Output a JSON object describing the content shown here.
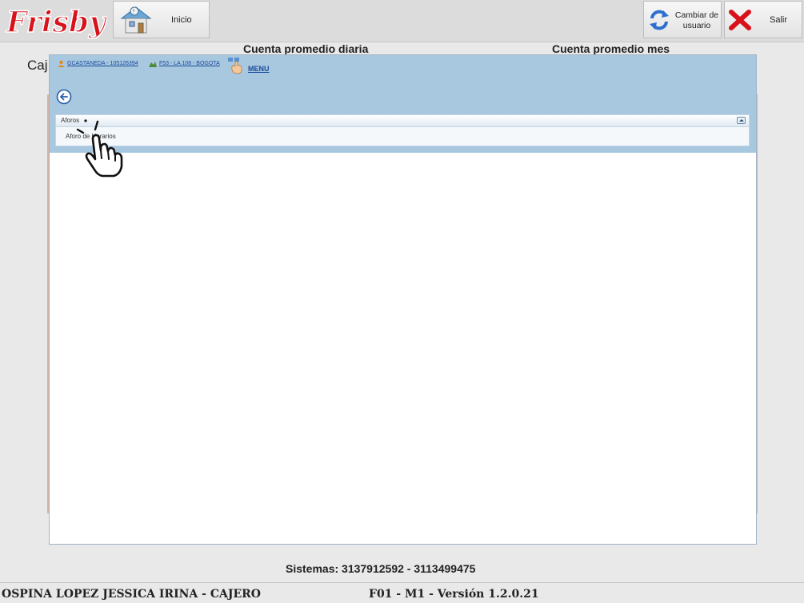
{
  "topbar": {
    "logo_text": "Frisby",
    "inicio_label": "Inicio",
    "cambiar_label": "Cambiar de usuario",
    "salir_label": "Salir"
  },
  "background": {
    "caja_label": "Caj",
    "cuenta_diaria": "Cuenta promedio diaria",
    "cuenta_mes": "Cuenta promedio mes"
  },
  "modal": {
    "user_link": "GCASTANEDA - 105126394",
    "store_link": "F53 - LA 108 - BOGOTA",
    "menu_link": "MENU",
    "panel_title": "Aforos",
    "panel_items": [
      "Aforo de Horarios"
    ]
  },
  "footer": {
    "sistemas": "Sistemas: 3137912592 - 3113499475",
    "user_role": "OSPINA LOPEZ JESSICA IRINA - CAJERO",
    "version": "F01 - M1  -  Versión 1.2.0.21"
  },
  "colors": {
    "brand_red": "#d8121b",
    "header_blue": "#a8c8e0",
    "link_blue": "#1a4a9a"
  }
}
